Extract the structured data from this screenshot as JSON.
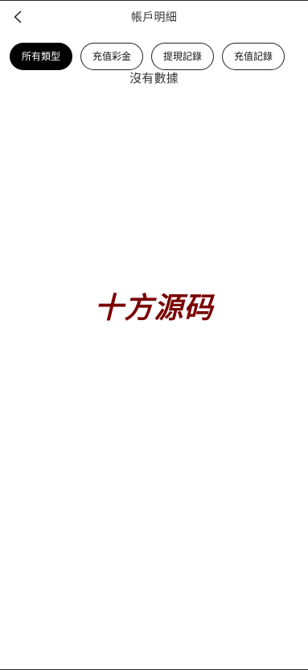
{
  "header": {
    "back_icon": "chevron-left-icon",
    "title": "帳戶明細"
  },
  "filters": [
    {
      "label": "所有類型",
      "active": true
    },
    {
      "label": "充值彩金",
      "active": false
    },
    {
      "label": "提現記錄",
      "active": false
    },
    {
      "label": "充值記錄",
      "active": false
    }
  ],
  "empty_state": {
    "message": "沒有數據"
  },
  "watermark": {
    "text": "十方源码",
    "color": "#7a0000"
  },
  "colors": {
    "active_pill_bg": "#000000",
    "active_pill_text": "#ffffff",
    "pill_border": "#222222",
    "text": "#333333"
  }
}
